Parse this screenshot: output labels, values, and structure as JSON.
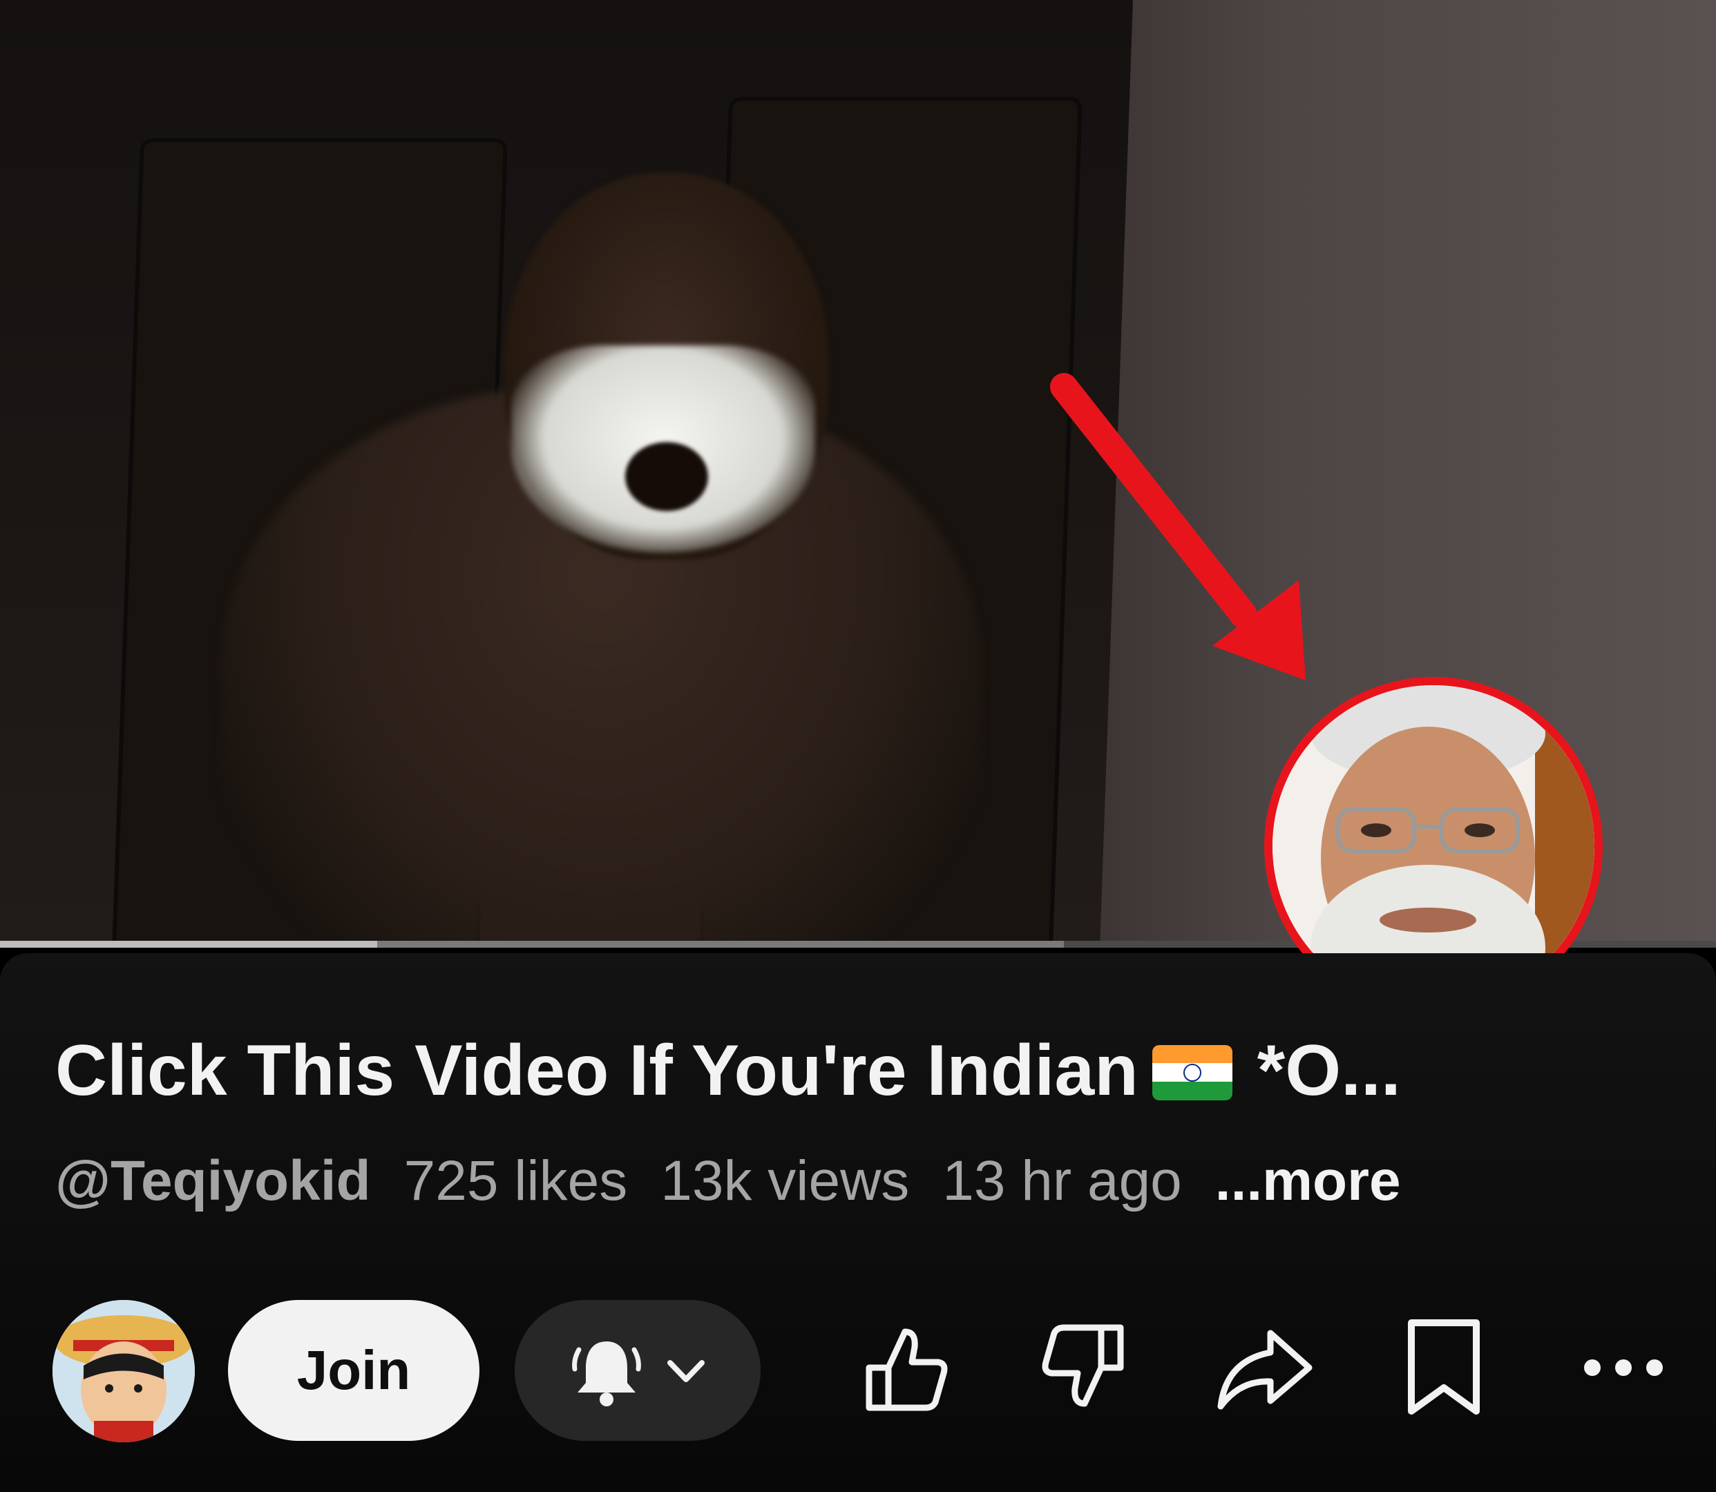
{
  "video": {
    "progress_played": 0.22,
    "progress_buffered": 0.62
  },
  "overlay": {
    "arrow_color": "#e8141c",
    "circle_color": "#e8141c"
  },
  "title": {
    "text": "Click This Video If You're Indian",
    "flag_icon": "india-flag-icon",
    "suffix": "*O..."
  },
  "meta": {
    "channel": "@Teqiyokid",
    "likes": "725 likes",
    "views": "13k views",
    "age": "13 hr ago",
    "more": "...more"
  },
  "actions": {
    "avatar_icon": "channel-avatar",
    "join_label": "Join",
    "bell_icon": "notification-bell-icon",
    "chevron_icon": "chevron-down-icon",
    "like_icon": "thumbs-up-icon",
    "dislike_icon": "thumbs-down-icon",
    "share_icon": "share-icon",
    "save_icon": "bookmark-icon",
    "more_icon": "more-options-icon"
  },
  "colors": {
    "panel_bg": "#0f0f0f",
    "title_text": "#f2f2f2",
    "meta_text": "#a5a5a5",
    "join_bg": "#f2f2f2",
    "bell_bg": "#272727"
  }
}
